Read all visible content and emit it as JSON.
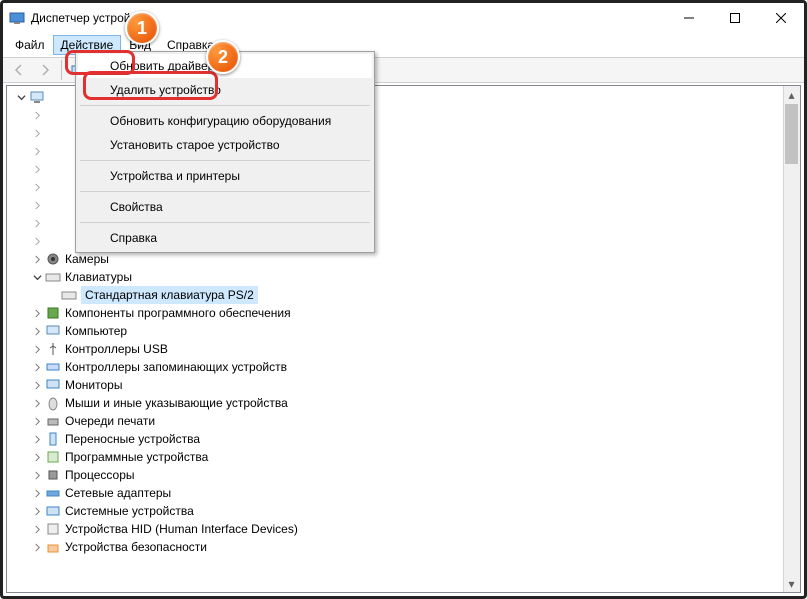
{
  "window": {
    "title": "Диспетчер устройств"
  },
  "menubar": {
    "file": "Файл",
    "action": "Действие",
    "view": "Вид",
    "help": "Справка"
  },
  "dropdown": {
    "update_driver": "Обновить драйвер",
    "uninstall_device": "Удалить устройство",
    "scan_hardware": "Обновить конфигурацию оборудования",
    "add_legacy": "Установить старое устройство",
    "devices_printers": "Устройства и принтеры",
    "properties": "Свойства",
    "help": "Справка"
  },
  "badges": {
    "one": "1",
    "two": "2"
  },
  "tree": {
    "cameras": "Камеры",
    "keyboards": "Клавиатуры",
    "keyboard_child": "Стандартная клавиатура PS/2",
    "software_components": "Компоненты программного обеспечения",
    "computer": "Компьютер",
    "usb_controllers": "Контроллеры USB",
    "storage_controllers": "Контроллеры запоминающих устройств",
    "monitors": "Мониторы",
    "mice": "Мыши и иные указывающие устройства",
    "print_queues": "Очереди печати",
    "portable": "Переносные устройства",
    "firmware": "Программные устройства",
    "processors": "Процессоры",
    "network": "Сетевые адаптеры",
    "system": "Системные устройства",
    "hid": "Устройства HID (Human Interface Devices)",
    "security": "Устройства безопасности"
  }
}
